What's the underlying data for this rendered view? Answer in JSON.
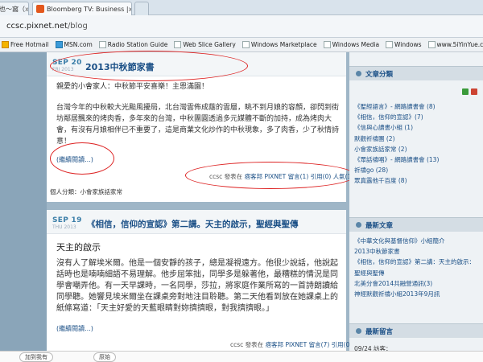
{
  "tabs": [
    {
      "label": "也～窩（",
      "close": "x"
    },
    {
      "label": "Bloomberg TV: Business |",
      "close": "x"
    }
  ],
  "address": {
    "scheme": "ccsc.pixnet.net",
    "path": "/blog"
  },
  "bookmarks": [
    "Free Hotmail",
    "MSN.com",
    "Radio Station Guide",
    "Web Slice Gallery",
    "Windows Marketplace",
    "Windows Media",
    "Windows",
    "www.5iYinYue.com"
  ],
  "post1": {
    "month_day": "SEP 20",
    "week_year": "FRI 2013",
    "title": "2013中秋節家書",
    "greeting": "親愛的小會家人：中秋節平安喜樂！主恩滿園！",
    "body": "台灣今年的中秋較大光颱風擾局，北台灣雲佈成蔭的雲層，眺不到月娘的容顏，卻閃到街坊鄰居飄來的烤肉香，多年來的台灣，中秋團圓透過多元媒體不斷的加持，成為烤肉大會，有沒有月娘相伴已不重要了，這是商業文化炒作的中秋現象，多了肉香，少了秋情詩意！",
    "more": "(繼續閱讀...)",
    "meta_prefix": "ccsc 發表在",
    "meta_author": "痞客邦 PIXNET 留言(1) 引用(0) 人氣(17)",
    "tags": "個人分類：小會家族話家常"
  },
  "post2": {
    "month_day": "SEP 19",
    "week_year": "THU 2013",
    "title": "《相信，信仰的宣認》第二講。天主的啟示，聖經與聖傳",
    "subtitle": "天主的啟示",
    "body": "沒有人了解埃米爾。他是一個安靜的孩子，總是凝視遠方。他很少說話，他說起話時也是喃喃細語不易理解。他步屈笨拙，同學多是躲著他，最糟糕的情況是同學會嘲弄他。有一天早課時，一名同學，莎拉，將家庭作業所寫的一首詩朗讀給同學聽。她響見埃米爾坐在課桌旁對地注目聆聽。第二天他看到放在她課桌上的紙條寫道：「天主好愛的天藍眼睛對妳擠擠眼，對我擠擠眼。」",
    "more": "(繼續閱讀...)",
    "meta_prefix": "ccsc 發表在",
    "meta_author": "痞客邦 PIXNET 留言(7) 引用(0) 人氣(65)"
  },
  "sidebar": {
    "categories_title": "文章分類",
    "categories": [
      "《聖經語言》- 網路讀書會 (8)",
      "《相信，信仰的宣認》(7)",
      "《信與心讀書小組 (1)",
      "默觀祈禱團 (2)",
      "小會家族話家常 (2)",
      "《眾話禱唱》- 網路讀書會 (13)",
      "祈禱go (28)",
      "眾真露他千百度 (8)"
    ],
    "recent_title": "最新文章",
    "recent": [
      "《中華文化與基督信仰》小組簡介",
      "2013中秋節家書",
      "《相信，信仰的宣認》第二講：天主的啟示：",
      "聖經與聖傳",
      "北美分會2014共融營通訊(3)",
      "神經默觀祈禱小組2013年9月訊"
    ],
    "comments_title": "最新留言",
    "comments": [
      "09/24 訪客："
    ]
  },
  "status": {
    "left_button": "加到我有",
    "right_button": "原始"
  }
}
